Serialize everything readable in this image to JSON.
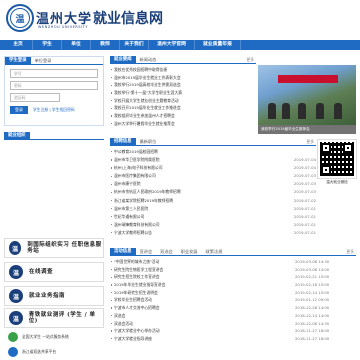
{
  "header": {
    "school_name": "温州大学",
    "school_en": "WENZHOU UNIVERSITY",
    "site_name": "就业信息网",
    "seal_char": "温"
  },
  "nav": [
    "主页",
    "学生",
    "单位",
    "教师",
    "关于我们",
    "温州大学官网",
    "就业质量年报"
  ],
  "login": {
    "title": "学生登录",
    "tab": "单位登录",
    "username_placeholder": "学号",
    "password_placeholder": "密码",
    "captcha_placeholder": "验证码",
    "button": "登录",
    "links": "学生注册 | 学生找回密码"
  },
  "orgs": {
    "title": "就业组织"
  },
  "banners": [
    {
      "icon": "温",
      "text": "到国际组织实习 任职信息服务站"
    },
    {
      "icon": "温",
      "text": "在线调查"
    },
    {
      "icon": "温",
      "text": "就业业务指南"
    },
    {
      "icon": "温",
      "text": "青铁就业测评 (学生 / 单位)"
    }
  ],
  "bottom_badges": [
    {
      "text": "全国大学生 一站式服务系统"
    },
    {
      "text": "浙江省双选共享平台"
    }
  ],
  "news": {
    "tab_active": "就业要闻",
    "tab_other": "新闻动态",
    "more": "更多",
    "items": [
      "我校在优秀校园招聘中取得佳绩",
      "温州市2019届毕业生就业工作表彰大会",
      "我校举行2019届高校毕业生供需双选会",
      "我校举行\"第十一届\"大学生职业生涯大赛",
      "学校开展大学生就业创业主题教育活动",
      "我校召开2019届毕业生就业工作推进会",
      "我校组织毕业生参加温州人才招聘会",
      "温州大学举行暑假毕业生就业推荐会"
    ]
  },
  "photo": {
    "caption": "我校举行2019届毕业生推荐会"
  },
  "jobs": {
    "tab_active": "招聘信息",
    "tab_other": "最新职位",
    "more": "更多",
    "items": [
      {
        "t": "中公教育2019届校园招聘",
        "d": ""
      },
      {
        "t": "温州市华卫医学院附属医院",
        "d": "2019-07-04"
      },
      {
        "t": "杭州(上海)电子科技有限公司",
        "d": "2019-07-04"
      },
      {
        "t": "温州市医疗集团有限公司",
        "d": "2019-07-03"
      },
      {
        "t": "温州市康宁医院",
        "d": "2019-07-03"
      },
      {
        "t": "杭州市余杭区人民政府2019年教师招聘",
        "d": "2019-07-03"
      },
      {
        "t": "浙江省某学院招聘2019年教师招聘",
        "d": "2019-07-02"
      },
      {
        "t": "温州市第三人民医院",
        "d": "2019-07-01"
      },
      {
        "t": "世纪华通有限公司",
        "d": "2019-07-01"
      },
      {
        "t": "温州瑞锋教育科技有限公司",
        "d": "2019-07-01"
      },
      {
        "t": "宁波大学教师招聘公告",
        "d": "2019-07-01"
      }
    ]
  },
  "qr": {
    "caption": "温大就业微信"
  },
  "events": {
    "tabs": [
      "活动信息",
      "宣讲会",
      "双选会",
      "职业发展",
      "政策法规"
    ],
    "more": "更多",
    "items": [
      {
        "t": "\"中国世界的城市之旅\"活动",
        "d": "2019-03-08 14:30"
      },
      {
        "t": "研究生院生物医学工程宣讲会",
        "d": "2019-03-08 14:00"
      },
      {
        "t": "研究生招生院校工作宣讲会",
        "d": "2019-02-21 15:00"
      },
      {
        "t": "2019年毕业生就业指导宣讲会",
        "d": "2019-02-18 15:00"
      },
      {
        "t": "2019年研究生招生说明会",
        "d": "2019-02-14 15:00"
      },
      {
        "t": "学校毕业生招聘会活动",
        "d": "2019-01-12 09:00"
      },
      {
        "t": "宁波市人才交流中心招聘会",
        "d": "2018-12-28 14:00"
      },
      {
        "t": "双选会",
        "d": "2018-12-14 14:00"
      },
      {
        "t": "双选会活动",
        "d": "2018-12-08 14:30"
      },
      {
        "t": "宁波大学就业中心举办活动",
        "d": "2018-11-27 18:00"
      },
      {
        "t": "宁波大学就业指导讲座",
        "d": "2018-11-27 18:00"
      }
    ]
  }
}
